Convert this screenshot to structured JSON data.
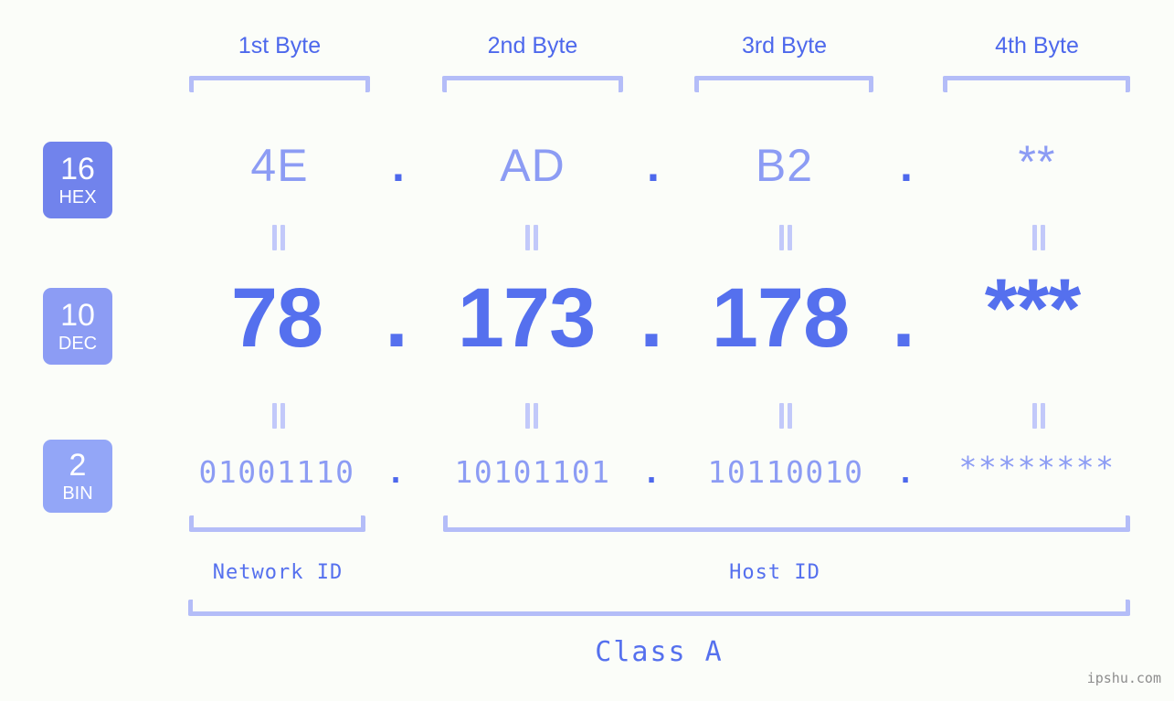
{
  "page": {
    "background": "#fbfdf9",
    "accent_dark": "#4d68ec",
    "accent_mid": "#5570ee",
    "accent_light": "#8c9cf4",
    "bracket_color": "#b4bdf8"
  },
  "byte_headers": [
    {
      "label": "1st Byte"
    },
    {
      "label": "2nd Byte"
    },
    {
      "label": "3rd Byte"
    },
    {
      "label": "4th Byte"
    }
  ],
  "bases": [
    {
      "id": "hex",
      "number": "16",
      "name": "HEX",
      "badge_color": "#7183ec"
    },
    {
      "id": "dec",
      "number": "10",
      "name": "DEC",
      "badge_color": "#8c9cf4"
    },
    {
      "id": "bin",
      "number": "2",
      "name": "BIN",
      "badge_color": "#93a6f7"
    }
  ],
  "rows": {
    "hex": {
      "values": [
        "4E",
        "AD",
        "B2",
        "**"
      ],
      "separator": "."
    },
    "dec": {
      "values": [
        "78",
        "173",
        "178",
        "***"
      ],
      "separator": "."
    },
    "bin": {
      "values": [
        "01001110",
        "10101101",
        "10110010",
        "********"
      ],
      "separator": "."
    }
  },
  "connectors": {
    "symbol": "equals-bars"
  },
  "segments": [
    {
      "key": "network",
      "label": "Network ID"
    },
    {
      "key": "host",
      "label": "Host ID"
    }
  ],
  "class": {
    "label": "Class A"
  },
  "watermark": {
    "text": "ipshu.com"
  }
}
